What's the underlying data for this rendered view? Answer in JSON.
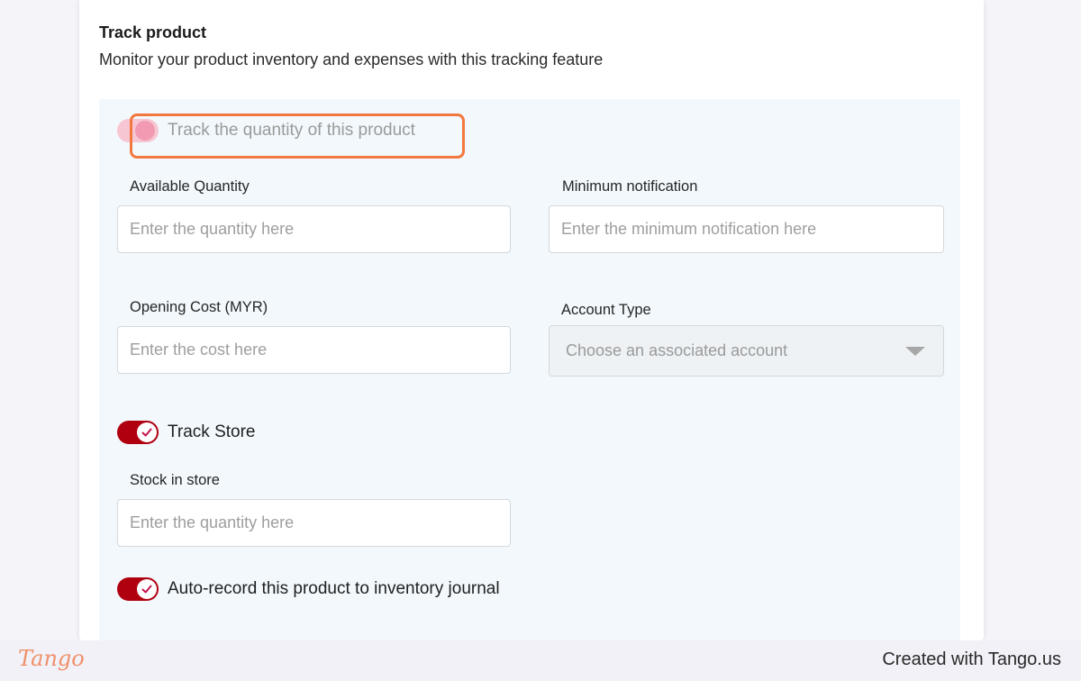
{
  "section": {
    "title": "Track product",
    "description": "Monitor your product inventory and expenses with this tracking feature"
  },
  "track_quantity": {
    "label": "Track the quantity of this product",
    "enabled": false
  },
  "fields": {
    "available_quantity": {
      "label": "Available Quantity",
      "placeholder": "Enter the quantity here"
    },
    "minimum_notification": {
      "label": "Minimum notification",
      "placeholder": "Enter the minimum notification here"
    },
    "opening_cost": {
      "label": "Opening Cost (MYR)",
      "placeholder": "Enter the cost here"
    },
    "account_type": {
      "label": "Account Type",
      "placeholder": "Choose an associated account"
    },
    "stock_in_store": {
      "label": "Stock in store",
      "placeholder": "Enter the quantity here"
    }
  },
  "track_store": {
    "label": "Track Store",
    "enabled": true
  },
  "auto_record": {
    "label": "Auto-record this product to inventory journal",
    "enabled": true
  },
  "footer": {
    "logo": "Tango",
    "credit": "Created with Tango.us"
  },
  "colors": {
    "toggle_on": "#b00010",
    "highlight": "#f3783f",
    "panel": "#f2f8fc"
  }
}
